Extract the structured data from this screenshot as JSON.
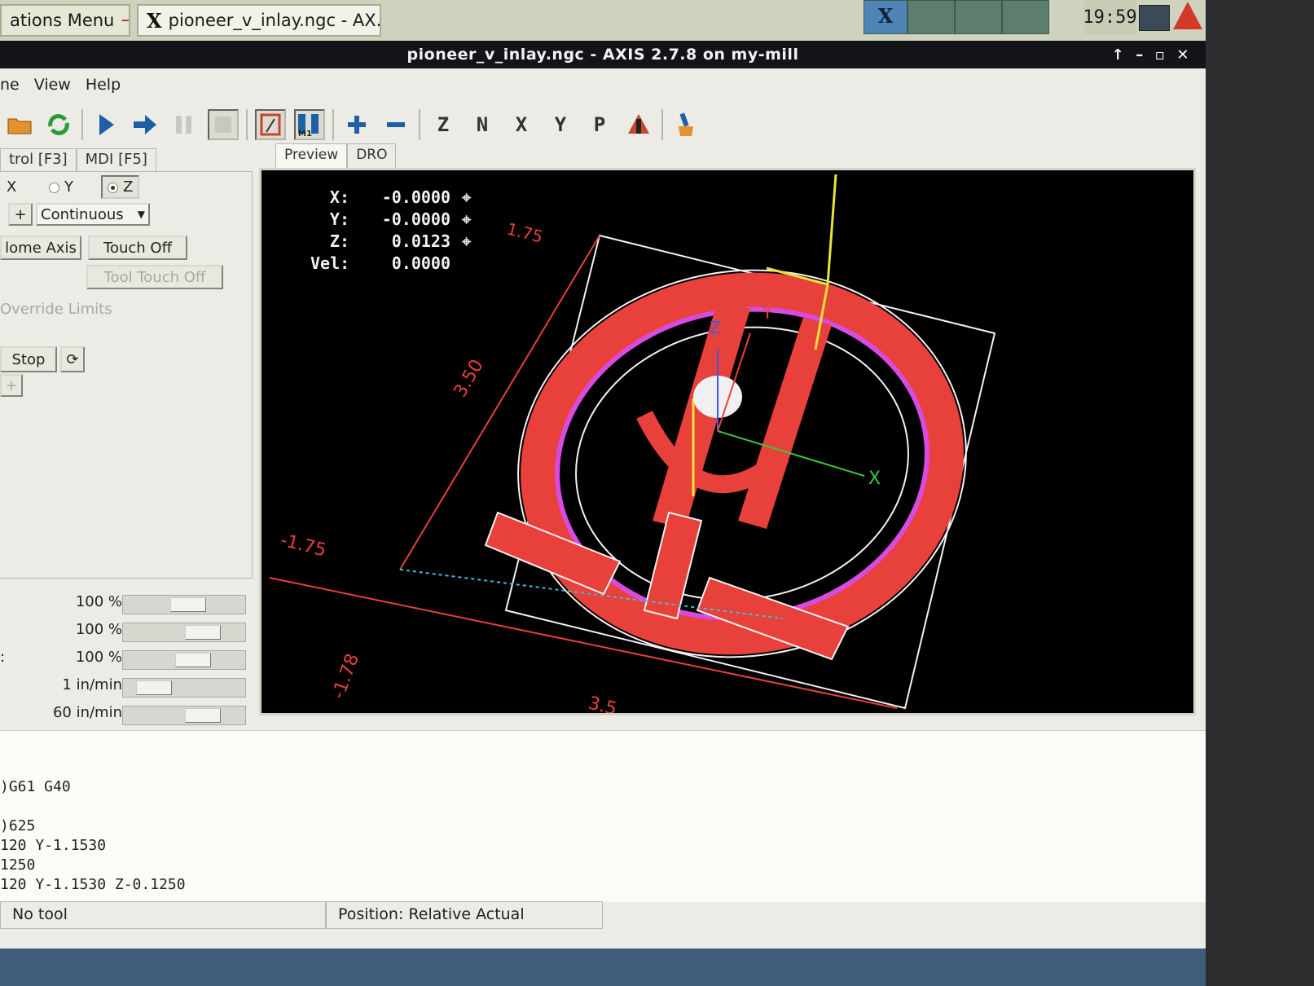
{
  "taskbar": {
    "apps_menu": "ations Menu",
    "window_task": "pioneer_v_inlay.ngc - AX...",
    "clock": "19:59"
  },
  "window": {
    "title": "pioneer_v_inlay.ngc - AXIS 2.7.8 on my-mill",
    "controls": [
      "↑",
      "–",
      "▫",
      "✕"
    ]
  },
  "menubar": {
    "items": [
      "ne",
      "View",
      "Help"
    ]
  },
  "toolbar": {
    "buttons": [
      "open-icon",
      "reload-icon",
      "run-icon",
      "step-icon",
      "pause-icon",
      "stop-icon",
      "block-delete-icon",
      "optional-stop-icon",
      "zoom-in-icon",
      "zoom-out-icon",
      "view-z-icon",
      "view-z2-icon",
      "view-x-icon",
      "view-y-icon",
      "view-p-icon",
      "rotate-icon",
      "clear-icon"
    ],
    "labels": {
      "z": "Z",
      "z2": "N",
      "x": "X",
      "y": "Y",
      "p": "P",
      "m1": "M1"
    }
  },
  "left": {
    "tabs": [
      "trol [F3]",
      "MDI [F5]"
    ],
    "axis": {
      "x": "X",
      "y": "Y",
      "z": "Z",
      "selected": "Z"
    },
    "jog": {
      "plus": "+",
      "mode": "Continuous"
    },
    "home_axis": "lome Axis",
    "touch_off": "Touch Off",
    "tool_touch_off": "Tool Touch Off",
    "override_limits": "Override Limits",
    "stop": "Stop",
    "small_plus": "+"
  },
  "sliders": [
    {
      "value": "100 %",
      "level": 0.55
    },
    {
      "value": "100 %",
      "level": 0.72
    },
    {
      "prefix": ":",
      "value": "100 %",
      "level": 0.6
    },
    {
      "value": "1 in/min",
      "level": 0.15
    },
    {
      "value": "60 in/min",
      "level": 0.72
    }
  ],
  "notebook": {
    "tabs": [
      "Preview",
      "DRO"
    ],
    "active": "Preview"
  },
  "dro": [
    {
      "axis": "X:",
      "value": "-0.0000"
    },
    {
      "axis": "Y:",
      "value": "-0.0000"
    },
    {
      "axis": "Z:",
      "value": "0.0123"
    },
    {
      "axis": "Vel:",
      "value": "0.0000"
    }
  ],
  "dimensions": {
    "top": "1.75",
    "left": "3.50",
    "left_min": "-1.75",
    "bottom_min": "-1.78",
    "bottom": "3.5",
    "axis_x": "X",
    "axis_y": "Y",
    "axis_z": "Z"
  },
  "gcode": [
    ")G61 G40",
    "",
    ")625",
    "120 Y-1.1530",
    "1250",
    "120 Y-1.1530 Z-0.1250"
  ],
  "status": {
    "tool": "No tool",
    "position": "Position: Relative Actual"
  },
  "colors": {
    "toolpath": "#e8403a",
    "feed": "#d74be0",
    "rapid": "#e8e23c",
    "stock": "#f2f2f2"
  }
}
